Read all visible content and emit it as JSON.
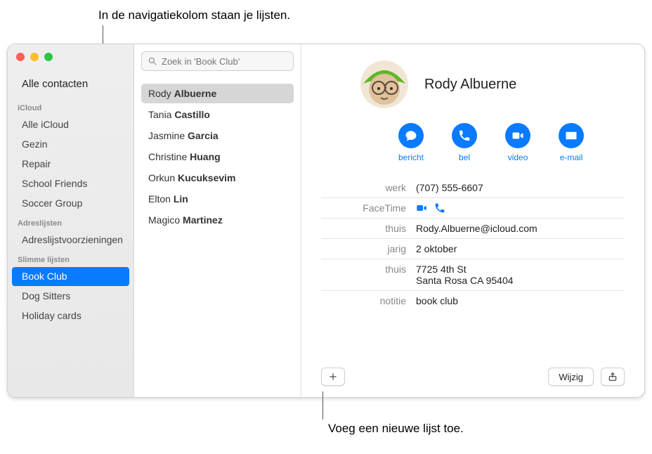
{
  "callouts": {
    "top": "In de navigatiekolom staan je lijsten.",
    "bottom": "Voeg een nieuwe lijst toe."
  },
  "sidebar": {
    "all_contacts": "Alle contacten",
    "sections": [
      {
        "title": "iCloud",
        "items": [
          "Alle iCloud",
          "Gezin",
          "Repair",
          "School Friends",
          "Soccer Group"
        ],
        "selected": -1
      },
      {
        "title": "Adreslijsten",
        "items": [
          "Adreslijstvoorzieningen"
        ],
        "selected": -1
      },
      {
        "title": "Slimme lijsten",
        "items": [
          "Book Club",
          "Dog Sitters",
          "Holiday cards"
        ],
        "selected": 0
      }
    ]
  },
  "search": {
    "placeholder": "Zoek in 'Book Club'"
  },
  "contacts": {
    "items": [
      {
        "first": "Rody",
        "last": "Albuerne"
      },
      {
        "first": "Tania",
        "last": "Castillo"
      },
      {
        "first": "Jasmine",
        "last": "Garcia"
      },
      {
        "first": "Christine",
        "last": "Huang"
      },
      {
        "first": "Orkun",
        "last": "Kucuksevim"
      },
      {
        "first": "Elton",
        "last": "Lin"
      },
      {
        "first": "Magico",
        "last": "Martinez"
      }
    ],
    "selected": 0
  },
  "card": {
    "name": "Rody Albuerne",
    "actions": {
      "message": "bericht",
      "call": "bel",
      "video": "video",
      "email": "e-mail"
    },
    "rows": [
      {
        "key": "werk",
        "value": "(707) 555-6607"
      },
      {
        "key": "FaceTime",
        "value": "",
        "facetime": true
      },
      {
        "key": "thuis",
        "value": "Rody.Albuerne@icloud.com"
      },
      {
        "key": "jarig",
        "value": "2 oktober"
      },
      {
        "key": "thuis",
        "value": "7725 4th St\nSanta Rosa CA 95404"
      },
      {
        "key": "notitie",
        "value": "book club"
      }
    ],
    "edit_label": "Wijzig"
  }
}
